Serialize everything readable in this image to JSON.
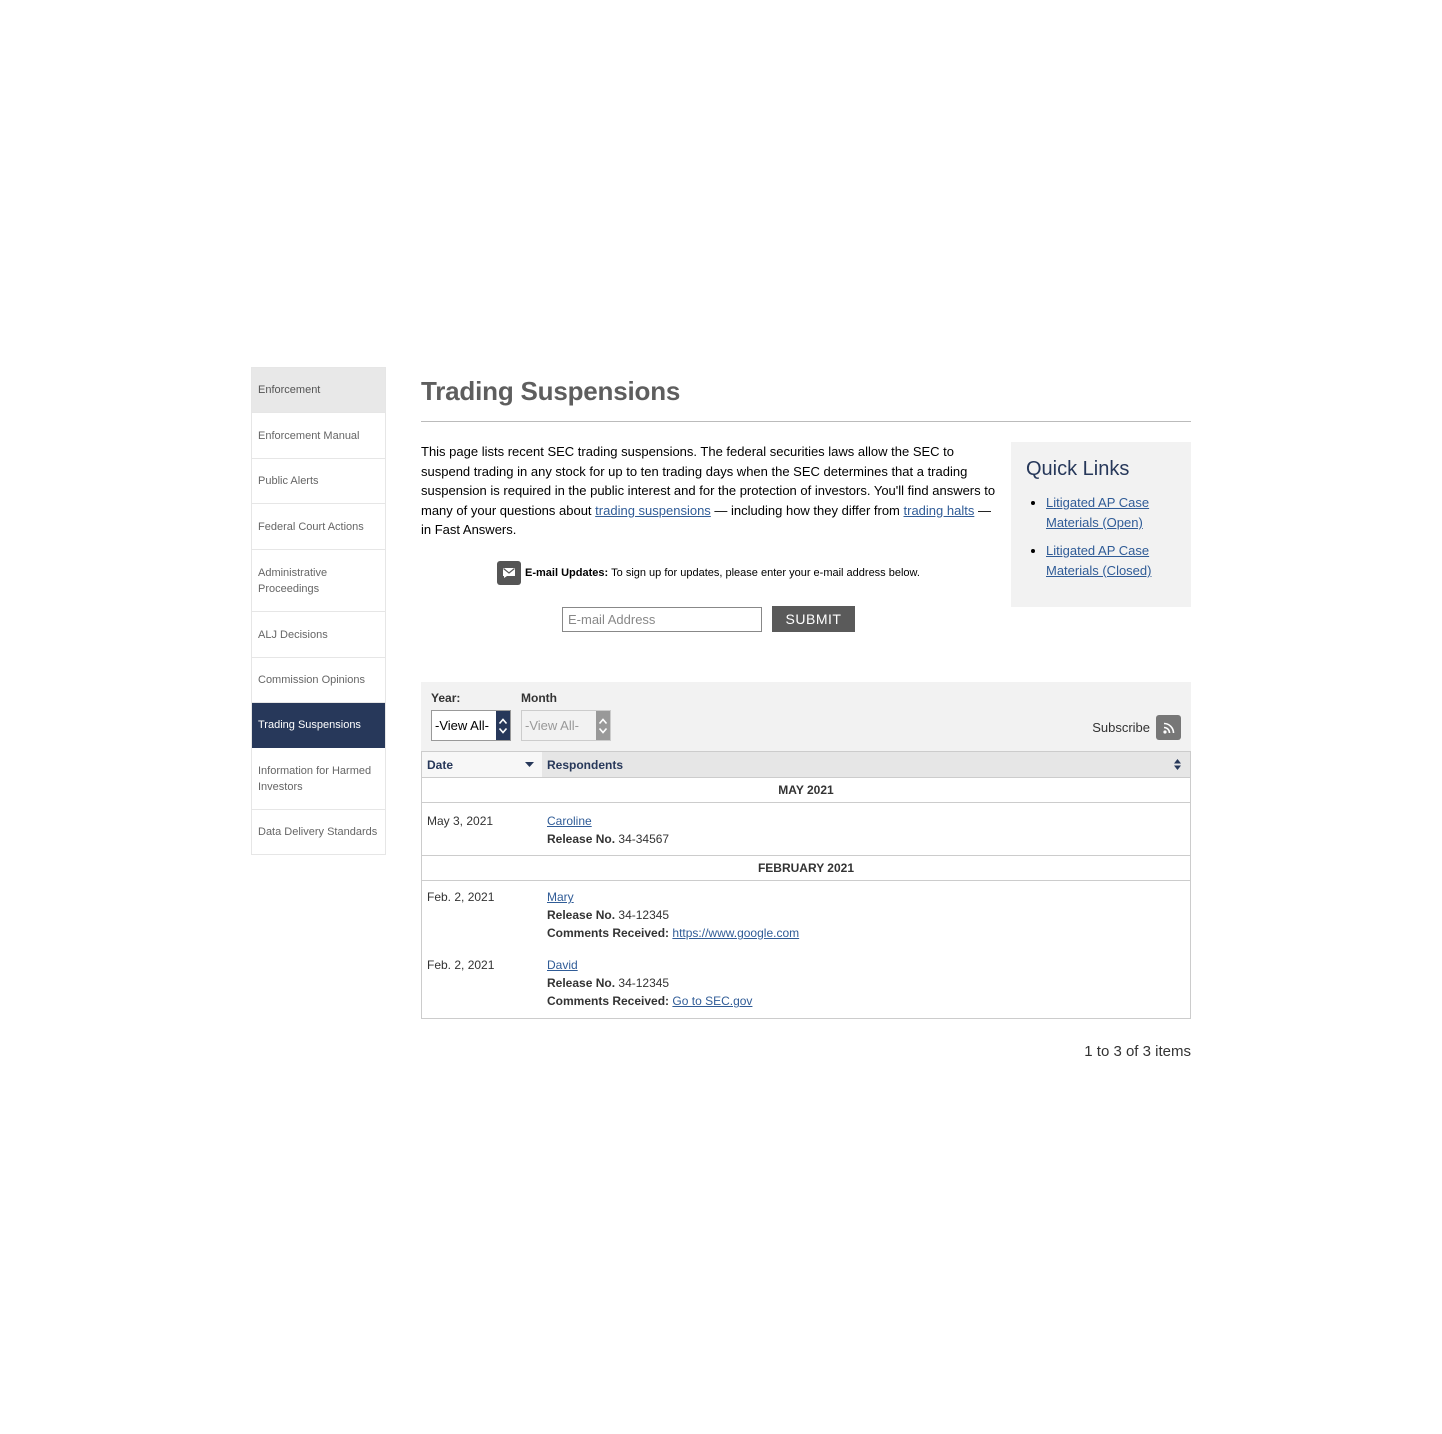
{
  "sidebar": {
    "items": [
      {
        "label": "Enforcement"
      },
      {
        "label": "Enforcement Manual"
      },
      {
        "label": "Public Alerts"
      },
      {
        "label": "Federal Court Actions"
      },
      {
        "label": "Administrative Proceedings"
      },
      {
        "label": "ALJ Decisions"
      },
      {
        "label": "Commission Opinions"
      },
      {
        "label": "Trading Suspensions"
      },
      {
        "label": "Information for Harmed Investors"
      },
      {
        "label": "Data Delivery Standards"
      }
    ]
  },
  "page": {
    "title": "Trading Suspensions",
    "intro_1": "This page lists recent SEC trading suspensions. The federal securities laws allow the SEC to suspend trading in any stock for up to ten trading days when the SEC determines that a trading suspension is required in the public interest and for the protection of investors. You'll find answers to many of your questions about ",
    "intro_link_1": "trading suspensions",
    "intro_2": " — including how they differ from ",
    "intro_link_2": "trading halts",
    "intro_3": " — in Fast Answers."
  },
  "quick_links": {
    "title": "Quick Links",
    "links": [
      {
        "label": "Litigated AP Case Materials (Open)"
      },
      {
        "label": "Litigated AP Case Materials (Closed)"
      }
    ]
  },
  "email": {
    "label": "E-mail Updates:",
    "text": "To sign up for updates, please enter your e-mail address below.",
    "placeholder": "E-mail Address",
    "submit": "SUBMIT"
  },
  "filters": {
    "year_label": "Year:",
    "year_value": "-View All-",
    "month_label": "Month",
    "month_value": "-View All-",
    "subscribe": "Subscribe"
  },
  "table": {
    "columns": {
      "date": "Date",
      "respondents": "Respondents"
    },
    "release_label": "Release No.",
    "comments_label": "Comments Received:",
    "groups": [
      {
        "label": "MAY 2021",
        "rows": [
          {
            "date": "May 3, 2021",
            "name": "Caroline",
            "release": "34-34567"
          }
        ]
      },
      {
        "label": "FEBRUARY 2021",
        "rows": [
          {
            "date": "Feb. 2, 2021",
            "name": "Mary",
            "release": "34-12345",
            "comments": "https://www.google.com"
          },
          {
            "date": "Feb. 2, 2021",
            "name": "David",
            "release": "34-12345",
            "comments": "Go to SEC.gov"
          }
        ]
      }
    ]
  },
  "pagination": {
    "text": "1 to 3 of 3 items"
  },
  "colors": {
    "navy": "#27385a",
    "link": "#305c97",
    "panel": "#f2f2f2"
  }
}
